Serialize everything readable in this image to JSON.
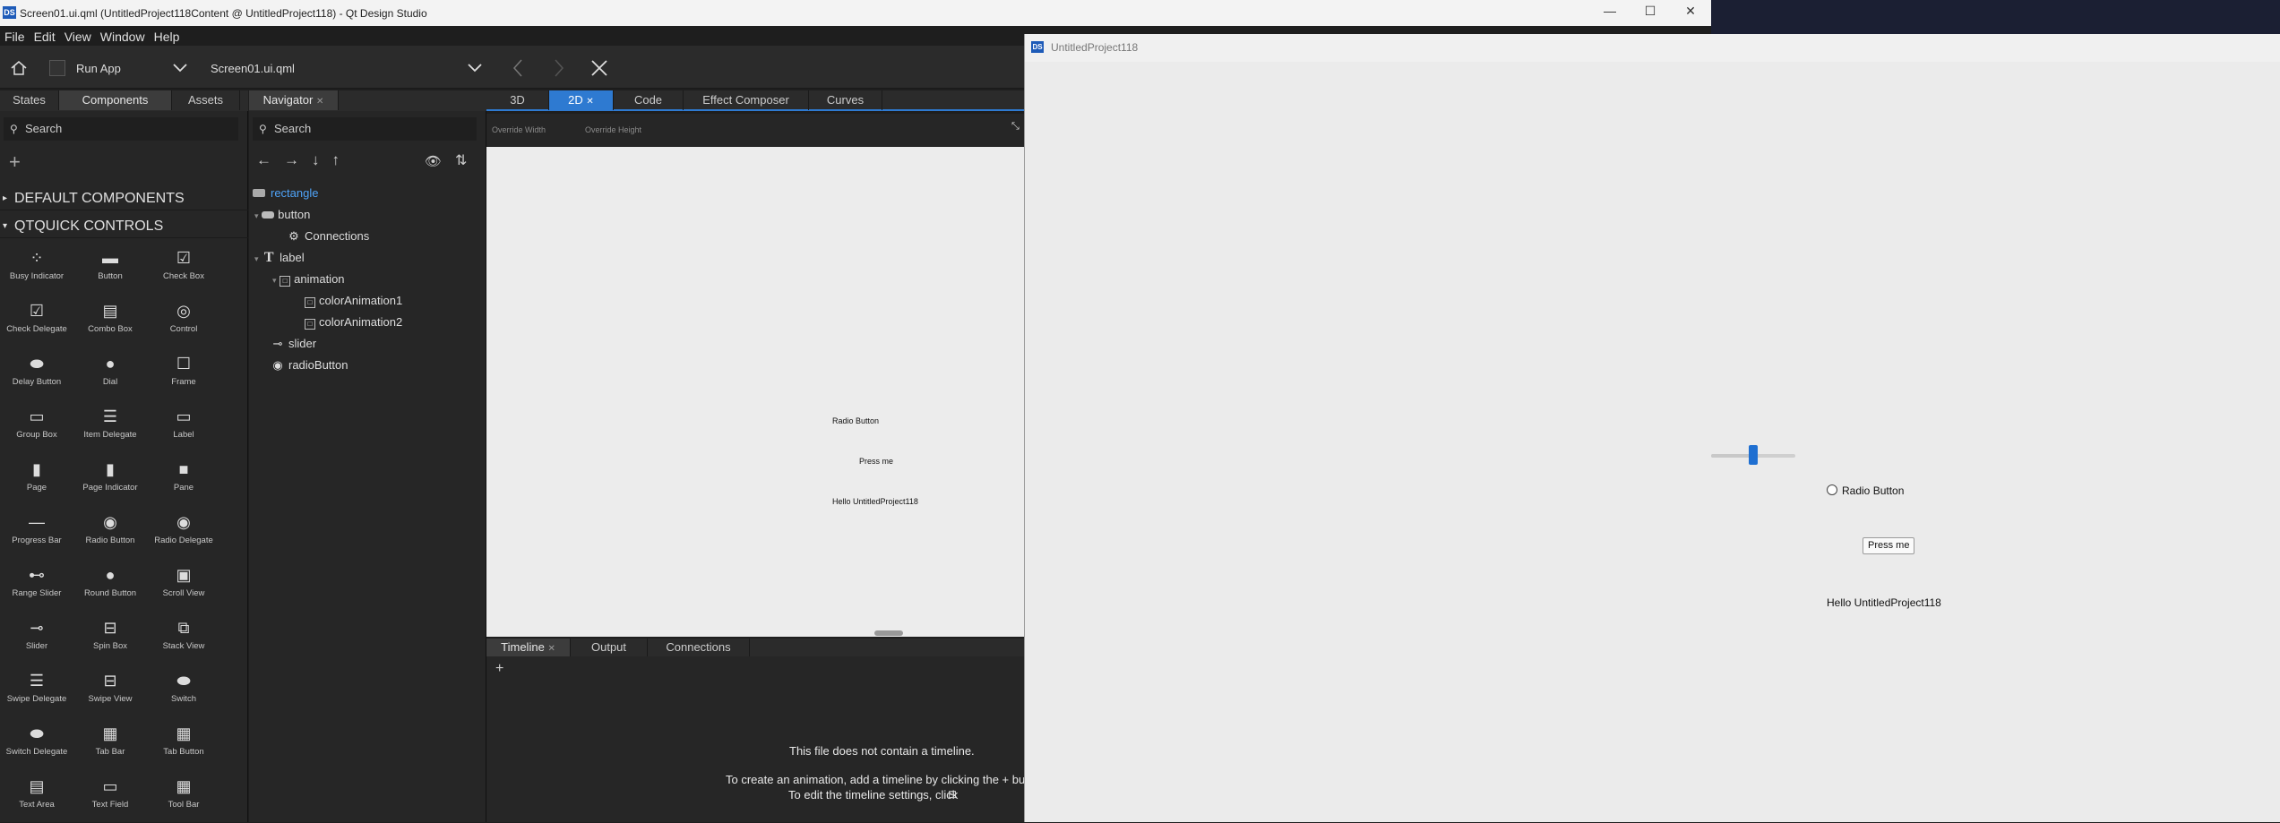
{
  "window_title": "Screen01.ui.qml (UntitledProject118Content @ UntitledProject118) - Qt Design Studio",
  "app_badge": "DS",
  "window_controls": {
    "minimize": "—",
    "maximize": "☐",
    "close": "✕"
  },
  "menu": [
    "File",
    "Edit",
    "View",
    "Window",
    "Help"
  ],
  "toolbar": {
    "run_app": "Run App",
    "file": "Screen01.ui.qml"
  },
  "left_tabs": [
    "States",
    "Components",
    "Assets"
  ],
  "left_search": "Search",
  "sections": {
    "default": "DEFAULT COMPONENTS",
    "qtquick": "QTQUICK CONTROLS"
  },
  "components": [
    "Busy Indicator",
    "Button",
    "Check Box",
    "Check Delegate",
    "Combo Box",
    "Control",
    "Delay Button",
    "Dial",
    "Frame",
    "Group Box",
    "Item Delegate",
    "Label",
    "Page",
    "Page Indicator",
    "Pane",
    "Progress Bar",
    "Radio Button",
    "Radio Delegate",
    "Range Slider",
    "Round Button",
    "Scroll View",
    "Slider",
    "Spin Box",
    "Stack View",
    "Swipe Delegate",
    "Swipe View",
    "Switch",
    "Switch Delegate",
    "Tab Bar",
    "Tab Button",
    "Text Area",
    "Text Field",
    "Tool Bar"
  ],
  "component_icons": [
    "busy-indicator",
    "button",
    "check-box",
    "check-delegate",
    "combo-box",
    "control",
    "delay-button",
    "dial",
    "frame",
    "group-box",
    "item-delegate",
    "label",
    "page",
    "page-indicator",
    "pane",
    "progress-bar",
    "radio-button",
    "radio-delegate",
    "range-slider",
    "round-button",
    "scroll-view",
    "slider",
    "spin-box",
    "stack-view",
    "swipe-delegate",
    "swipe-view",
    "switch",
    "switch-delegate",
    "tab-bar",
    "tab-button",
    "text-area",
    "text-field",
    "tool-bar"
  ],
  "navigator": {
    "tab": "Navigator",
    "search": "Search",
    "items": [
      "rectangle",
      "button",
      "Connections",
      "label",
      "animation",
      "colorAnimation1",
      "colorAnimation2",
      "slider",
      "radioButton"
    ]
  },
  "editor_tabs": [
    "3D",
    "2D",
    "Code",
    "Effect Composer",
    "Curves"
  ],
  "override": {
    "width": "Override Width",
    "height": "Override Height"
  },
  "canvas": {
    "radio": "Radio Button",
    "press": "Press me",
    "hello": "Hello UntitledProject118"
  },
  "bottom_tabs": [
    "Timeline",
    "Output",
    "Connections"
  ],
  "timeline": {
    "line1": "This file does not contain a timeline.",
    "line2": "To create an animation, add a timeline by clicking the + button.",
    "line3": "To edit the timeline settings, click",
    "add": "+"
  },
  "app_window": {
    "title": "UntitledProject118",
    "radio": "Radio Button",
    "press": "Press me",
    "hello": "Hello UntitledProject118",
    "slider_value": 0.5
  },
  "colors": {
    "accent": "#2e7ad1",
    "selected_item": "#4fa3f7",
    "slider_handle": "#1f6fd1"
  }
}
